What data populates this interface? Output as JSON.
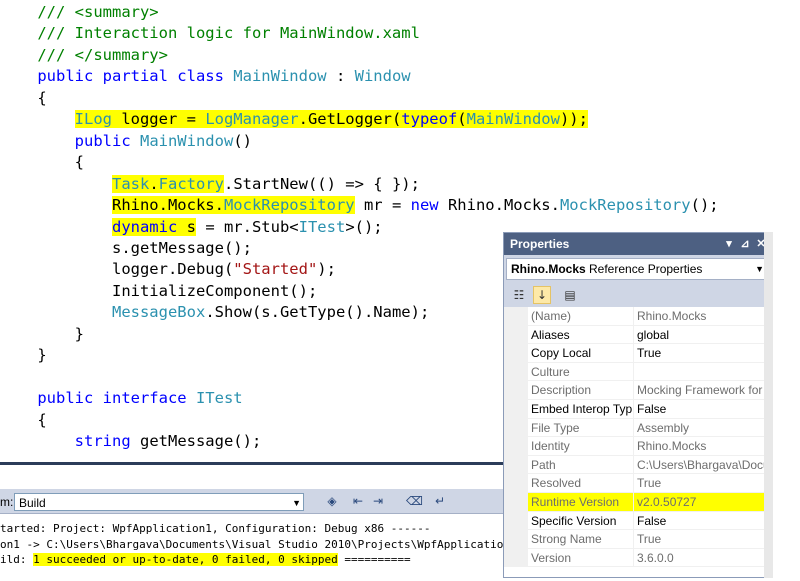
{
  "code_lines": [
    [
      [
        "c",
        "    /// <summary>"
      ]
    ],
    [
      [
        "c",
        "    /// Interaction logic for MainWindow.xaml"
      ]
    ],
    [
      [
        "c",
        "    /// </summary>"
      ]
    ],
    [
      [
        "k",
        "    public partial class "
      ],
      [
        "t",
        "MainWindow"
      ],
      [
        "p",
        " : "
      ],
      [
        "t",
        "Window"
      ]
    ],
    [
      [
        "p",
        "    {"
      ]
    ],
    [
      [
        "p",
        "        "
      ],
      [
        "t",
        "ILog",
        "hl"
      ],
      [
        "p",
        " logger = ",
        "hl"
      ],
      [
        "t",
        "LogManager",
        "hl"
      ],
      [
        "p",
        ".GetLogger(",
        "hl"
      ],
      [
        "k",
        "typeof",
        "hl"
      ],
      [
        "p",
        "(",
        "hl"
      ],
      [
        "t",
        "MainWindow",
        "hl"
      ],
      [
        "p",
        "));",
        "hl"
      ]
    ],
    [
      [
        "k",
        "        public "
      ],
      [
        "t",
        "MainWindow"
      ],
      [
        "p",
        "()"
      ]
    ],
    [
      [
        "p",
        "        {"
      ]
    ],
    [
      [
        "p",
        "            "
      ],
      [
        "t",
        "Task",
        "hl"
      ],
      [
        "p",
        ".",
        "hl"
      ],
      [
        "t",
        "Factory",
        "hl"
      ],
      [
        "p",
        ".StartNew(() => { });"
      ]
    ],
    [
      [
        "p",
        "            "
      ],
      [
        "p",
        "Rhino.Mocks.",
        "hl"
      ],
      [
        "t",
        "MockRepository",
        "hl"
      ],
      [
        "p",
        " mr = "
      ],
      [
        "k",
        "new"
      ],
      [
        "p",
        " Rhino.Mocks."
      ],
      [
        "t",
        "MockRepository"
      ],
      [
        "p",
        "();"
      ]
    ],
    [
      [
        "p",
        "            "
      ],
      [
        "k",
        "dynamic",
        "hl"
      ],
      [
        "p",
        " s",
        "hl"
      ],
      [
        "p",
        " = mr.Stub<"
      ],
      [
        "t",
        "ITest"
      ],
      [
        "p",
        ">();"
      ]
    ],
    [
      [
        "p",
        "            s.getMessage();"
      ]
    ],
    [
      [
        "p",
        "            logger.Debug("
      ],
      [
        "s",
        "\"Started\""
      ],
      [
        "p",
        ");"
      ]
    ],
    [
      [
        "p",
        "            InitializeComponent();"
      ]
    ],
    [
      [
        "p",
        "            "
      ],
      [
        "t",
        "MessageBox"
      ],
      [
        "p",
        ".Show(s.GetType().Name);"
      ]
    ],
    [
      [
        "p",
        "        }"
      ]
    ],
    [
      [
        "p",
        "    }"
      ]
    ],
    [
      [
        "p",
        ""
      ]
    ],
    [
      [
        "k",
        "    public interface "
      ],
      [
        "t",
        "ITest"
      ]
    ],
    [
      [
        "p",
        "    {"
      ]
    ],
    [
      [
        "p",
        "        "
      ],
      [
        "k",
        "string"
      ],
      [
        "p",
        " getMessage();"
      ]
    ]
  ],
  "output": {
    "show_label": "m:",
    "combo_value": "Build",
    "lines": [
      [
        [
          "p",
          "tarted: Project: WpfApplication1, Configuration: Debug x86 ------"
        ]
      ],
      [
        [
          "p",
          "on1 -> C:\\Users\\Bhargava\\Documents\\Visual Studio 2010\\Projects\\WpfApplication1\\WpfApp"
        ]
      ],
      [
        [
          "p",
          "ild: "
        ],
        [
          "p",
          "1 succeeded or up-to-date, 0 failed, 0 skipped",
          "hl"
        ],
        [
          "p",
          " =========="
        ]
      ]
    ]
  },
  "properties": {
    "title": "Properties",
    "title_buttons": [
      "▾",
      "⊿",
      "✕"
    ],
    "selector_bold": "Rhino.Mocks",
    "selector_rest": " Reference Properties",
    "rows": [
      {
        "name": "(Name)",
        "value": "Rhino.Mocks",
        "ro": true,
        "hl": false
      },
      {
        "name": "Aliases",
        "value": "global",
        "ro": false,
        "hl": false
      },
      {
        "name": "Copy Local",
        "value": "True",
        "ro": false,
        "hl": false
      },
      {
        "name": "Culture",
        "value": "",
        "ro": true,
        "hl": false
      },
      {
        "name": "Description",
        "value": "Mocking Framework for .",
        "ro": true,
        "hl": false
      },
      {
        "name": "Embed Interop Typ",
        "value": "False",
        "ro": false,
        "hl": false
      },
      {
        "name": "File Type",
        "value": "Assembly",
        "ro": true,
        "hl": false
      },
      {
        "name": "Identity",
        "value": "Rhino.Mocks",
        "ro": true,
        "hl": false
      },
      {
        "name": "Path",
        "value": "C:\\Users\\Bhargava\\Docu",
        "ro": true,
        "hl": false
      },
      {
        "name": "Resolved",
        "value": "True",
        "ro": true,
        "hl": false
      },
      {
        "name": "Runtime Version",
        "value": "v2.0.50727",
        "ro": true,
        "hl": true
      },
      {
        "name": "Specific Version",
        "value": "False",
        "ro": false,
        "hl": false
      },
      {
        "name": "Strong Name",
        "value": "True",
        "ro": true,
        "hl": false
      },
      {
        "name": "Version",
        "value": "3.6.0.0",
        "ro": true,
        "hl": false
      }
    ]
  },
  "colors": {
    "comment": "#008000",
    "keyword": "#0000ff",
    "type": "#2b91af",
    "string": "#a31515",
    "highlight": "#ffff00"
  }
}
